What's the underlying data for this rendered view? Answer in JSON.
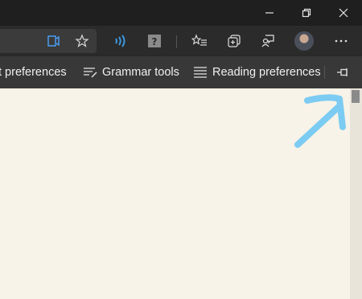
{
  "window": {
    "minimize_icon": "minimize-icon",
    "restore_icon": "restore-icon",
    "close_icon": "close-icon"
  },
  "toolbar": {
    "icons": [
      "immersive-reader-icon",
      "favorite-star-icon",
      "read-aloud-icon",
      "help-icon",
      "favorites-list-icon",
      "collections-icon",
      "feedback-icon",
      "profile-avatar",
      "more-options-icon"
    ]
  },
  "reading_bar": {
    "items": [
      {
        "label": "t preferences",
        "icon": "text-preferences-icon"
      },
      {
        "label": "Grammar tools",
        "icon": "grammar-tools-icon"
      },
      {
        "label": "Reading preferences",
        "icon": "reading-preferences-icon"
      }
    ],
    "pin_icon": "pin-icon"
  },
  "annotation": {
    "arrow_color": "#7ccbf2"
  },
  "colors": {
    "page_background": "#f7f3e8",
    "read_aloud_accent": "#3a96dd"
  }
}
